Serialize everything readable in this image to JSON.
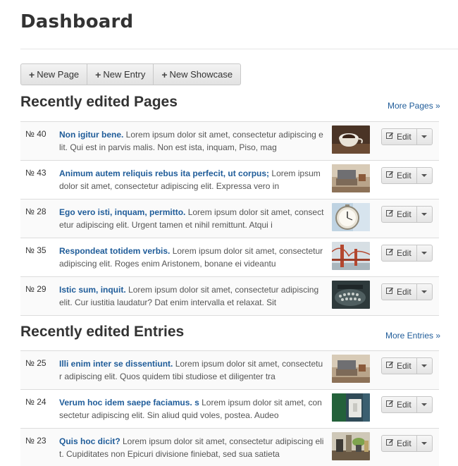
{
  "page": {
    "title": "Dashboard"
  },
  "toolbar": {
    "new_page": "New Page",
    "new_entry": "New Entry",
    "new_showcase": "New Showcase"
  },
  "pages_section": {
    "title": "Recently edited Pages",
    "more_link": "More Pages »",
    "rows": [
      {
        "num": "№ 40",
        "headline": "Non igitur bene.",
        "body": " Lorem ipsum dolor sit amet, consectetur adipiscing elit. Qui est in parvis malis. Non est ista, inquam, Piso, mag",
        "edit": "Edit",
        "thumb": "coffee-cup-image"
      },
      {
        "num": "№ 43",
        "headline": "Animum autem reliquis rebus ita perfecit, ut corpus;",
        "body": " Lorem ipsum dolor sit amet, consectetur adipiscing elit. Expressa vero in",
        "edit": "Edit",
        "thumb": "desk-laptop-image"
      },
      {
        "num": "№ 28",
        "headline": "Ego vero isti, inquam, permitto.",
        "body": " Lorem ipsum dolor sit amet, consectetur adipiscing elit. Urgent tamen et nihil remittunt. Atqui i",
        "edit": "Edit",
        "thumb": "clock-image"
      },
      {
        "num": "№ 35",
        "headline": "Respondeat totidem verbis.",
        "body": " Lorem ipsum dolor sit amet, consectetur adipiscing elit. Roges enim Aristonem, bonane ei videantu",
        "edit": "Edit",
        "thumb": "bridge-image"
      },
      {
        "num": "№ 29",
        "headline": "Istic sum, inquit.",
        "body": " Lorem ipsum dolor sit amet, consectetur adipiscing elit. Cur iustitia laudatur? Dat enim intervalla et relaxat. Sit",
        "edit": "Edit",
        "thumb": "typewriter-image"
      }
    ]
  },
  "entries_section": {
    "title": "Recently edited Entries",
    "more_link": "More Entries »",
    "rows": [
      {
        "num": "№ 25",
        "headline": "Illi enim inter se dissentiunt.",
        "body": " Lorem ipsum dolor sit amet, consectetur adipiscing elit. Quos quidem tibi studiose et diligenter tra",
        "edit": "Edit",
        "thumb": "desk-laptop-image"
      },
      {
        "num": "№ 24",
        "headline": "Verum hoc idem saepe faciamus. s",
        "body": " Lorem ipsum dolor sit amet, consectetur adipiscing elit. Sin aliud quid voles, postea. Audeo",
        "edit": "Edit",
        "thumb": "wall-switch-image"
      },
      {
        "num": "№ 23",
        "headline": "Quis hoc dicit?",
        "body": " Lorem ipsum dolor sit amet, consectetur adipiscing elit. Cupiditates non Epicuri divisione finiebat, sed sua satieta",
        "edit": "Edit",
        "thumb": "kitchen-image"
      }
    ]
  },
  "colors": {
    "link": "#1f5c99",
    "row_alt": "#fafafa",
    "border": "#dcdcdc"
  }
}
